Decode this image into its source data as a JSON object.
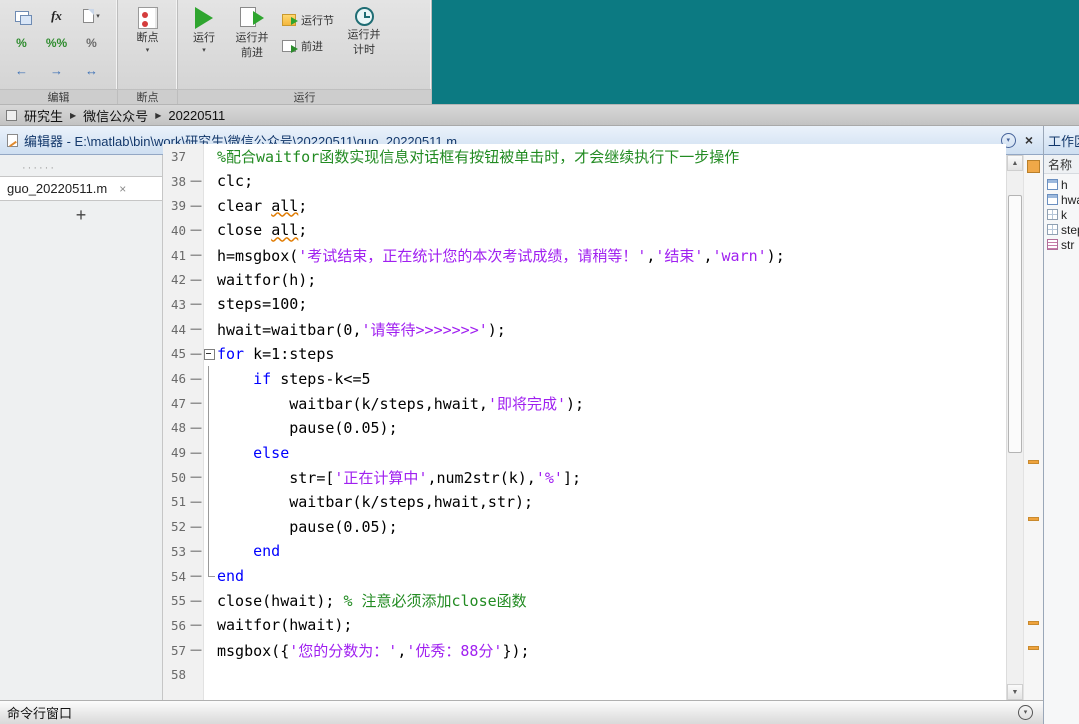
{
  "icons": {
    "bc_sep": "▶",
    "chevron": "▾",
    "close": "×",
    "scroll_up": "▲",
    "scroll_down": "▼",
    "dots": "······",
    "plus": "+"
  },
  "colors": {
    "teal": "#0c7a82",
    "keyword": "#0000ff",
    "string": "#a020f0",
    "comment": "#228b22",
    "warning_marker": "#efa33d"
  },
  "ribbon": {
    "groups": [
      {
        "label": "编辑"
      },
      {
        "label": "断点"
      },
      {
        "label": "运行"
      }
    ],
    "edit_icons": {
      "fx": "fx",
      "comment": "%",
      "comment_block": "%%",
      "uncomment": "%",
      "indent_left": "←",
      "indent_right": "→",
      "indent_both": "↔"
    },
    "breakpoints": {
      "label": "断点"
    },
    "run": {
      "label": "运行"
    },
    "run_advance": {
      "line1": "运行并",
      "line2": "前进"
    },
    "run_section": {
      "label": "运行节"
    },
    "advance": {
      "label": "前进"
    },
    "run_time": {
      "line1": "运行并",
      "line2": "计时"
    }
  },
  "breadcrumb": {
    "items": [
      "研究生",
      "微信公众号",
      "20220511"
    ]
  },
  "editor": {
    "titlebar": "编辑器 - E:\\matlab\\bin\\work\\研究生\\微信公众号\\20220511\\guo_20220511.m",
    "tab": "guo_20220511.m",
    "lines": [
      {
        "n": 37,
        "d": false,
        "t": [
          {
            "c": "comment",
            "s": "%配合waitfor函数实现信息对话框有按钮被单击时，才会继续执行下一步操作"
          }
        ]
      },
      {
        "n": 38,
        "d": true,
        "t": [
          {
            "c": "code",
            "s": "clc;"
          }
        ]
      },
      {
        "n": 39,
        "d": true,
        "t": [
          {
            "c": "code",
            "s": "clear "
          },
          {
            "c": "code",
            "u": true,
            "s": "all"
          },
          {
            "c": "code",
            "s": ";"
          }
        ]
      },
      {
        "n": 40,
        "d": true,
        "t": [
          {
            "c": "code",
            "s": "close "
          },
          {
            "c": "code",
            "u": true,
            "s": "all"
          },
          {
            "c": "code",
            "s": ";"
          }
        ]
      },
      {
        "n": 41,
        "d": true,
        "t": [
          {
            "c": "code",
            "s": "h=msgbox("
          },
          {
            "c": "string",
            "s": "'考试结束，正在统计您的本次考试成绩，请稍等！'"
          },
          {
            "c": "code",
            "s": ","
          },
          {
            "c": "string",
            "s": "'结束'"
          },
          {
            "c": "code",
            "s": ","
          },
          {
            "c": "string",
            "s": "'warn'"
          },
          {
            "c": "code",
            "s": ");"
          }
        ]
      },
      {
        "n": 42,
        "d": true,
        "t": [
          {
            "c": "code",
            "s": "waitfor(h);"
          }
        ]
      },
      {
        "n": 43,
        "d": true,
        "t": [
          {
            "c": "code",
            "s": "steps=100;"
          }
        ]
      },
      {
        "n": 44,
        "d": true,
        "t": [
          {
            "c": "code",
            "s": "hwait=waitbar(0,"
          },
          {
            "c": "string",
            "s": "'请等待>>>>>>>'"
          },
          {
            "c": "code",
            "s": ");"
          }
        ]
      },
      {
        "n": 45,
        "d": true,
        "f": "start",
        "t": [
          {
            "c": "keyword",
            "s": "for"
          },
          {
            "c": "code",
            "s": " k=1:steps"
          }
        ]
      },
      {
        "n": 46,
        "d": true,
        "f": "mid",
        "t": [
          {
            "c": "code",
            "s": "    "
          },
          {
            "c": "keyword",
            "s": "if"
          },
          {
            "c": "code",
            "s": " steps-k<=5"
          }
        ]
      },
      {
        "n": 47,
        "d": true,
        "f": "mid",
        "t": [
          {
            "c": "code",
            "s": "        waitbar(k/steps,hwait,"
          },
          {
            "c": "string",
            "s": "'即将完成'"
          },
          {
            "c": "code",
            "s": ");"
          }
        ]
      },
      {
        "n": 48,
        "d": true,
        "f": "mid",
        "t": [
          {
            "c": "code",
            "s": "        pause(0.05);"
          }
        ]
      },
      {
        "n": 49,
        "d": true,
        "f": "mid",
        "t": [
          {
            "c": "code",
            "s": "    "
          },
          {
            "c": "keyword",
            "s": "else"
          }
        ]
      },
      {
        "n": 50,
        "d": true,
        "f": "mid",
        "t": [
          {
            "c": "code",
            "s": "        str=["
          },
          {
            "c": "string",
            "s": "'正在计算中'"
          },
          {
            "c": "code",
            "s": ",num2str(k),"
          },
          {
            "c": "string",
            "s": "'%'"
          },
          {
            "c": "code",
            "s": "];"
          }
        ]
      },
      {
        "n": 51,
        "d": true,
        "f": "mid",
        "t": [
          {
            "c": "code",
            "s": "        waitbar(k/steps,hwait,str);"
          }
        ]
      },
      {
        "n": 52,
        "d": true,
        "f": "mid",
        "t": [
          {
            "c": "code",
            "s": "        pause(0.05);"
          }
        ]
      },
      {
        "n": 53,
        "d": true,
        "f": "mid",
        "t": [
          {
            "c": "code",
            "s": "    "
          },
          {
            "c": "keyword",
            "s": "end"
          }
        ]
      },
      {
        "n": 54,
        "d": true,
        "f": "end",
        "t": [
          {
            "c": "keyword",
            "s": "end"
          }
        ]
      },
      {
        "n": 55,
        "d": true,
        "t": [
          {
            "c": "code",
            "s": "close(hwait); "
          },
          {
            "c": "comment",
            "s": "% 注意必须添加close函数"
          }
        ]
      },
      {
        "n": 56,
        "d": true,
        "t": [
          {
            "c": "code",
            "s": "waitfor(hwait);"
          }
        ]
      },
      {
        "n": 57,
        "d": true,
        "t": [
          {
            "c": "code",
            "s": "msgbox({"
          },
          {
            "c": "string",
            "s": "'您的分数为：'"
          },
          {
            "c": "code",
            "s": ","
          },
          {
            "c": "string",
            "s": "'优秀：88分'"
          },
          {
            "c": "code",
            "s": "});"
          }
        ]
      },
      {
        "n": 58,
        "d": false,
        "t": []
      }
    ]
  },
  "workspace": {
    "title": "工作区",
    "name_header": "名称",
    "items": [
      {
        "icon": "figure-icon",
        "name": "h"
      },
      {
        "icon": "figure-icon",
        "name": "hwait"
      },
      {
        "icon": "matrix-icon",
        "name": "k"
      },
      {
        "icon": "matrix-icon",
        "name": "steps"
      },
      {
        "icon": "char-icon",
        "name": "str"
      }
    ]
  },
  "statusbar": {
    "label": "命令行窗口"
  }
}
